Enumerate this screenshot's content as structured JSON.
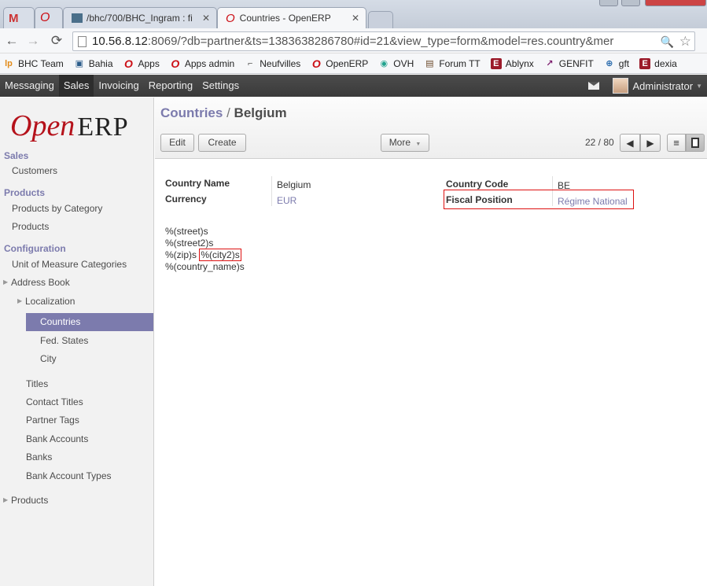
{
  "browser": {
    "tabs": [
      {
        "title": ""
      },
      {
        "title": ""
      },
      {
        "title": "/bhc/700/BHC_Ingram : fi"
      },
      {
        "title": "Countries - OpenERP"
      }
    ],
    "url_host": "10.56.8.12",
    "url_rest": ":8069/?db=partner&ts=1383638286780#id=21&view_type=form&model=res.country&mer",
    "bookmarks": [
      {
        "label": "BHC Team",
        "icon": "lp-icon",
        "color": "#e38c1a"
      },
      {
        "label": "Bahia",
        "icon": "bahia-icon",
        "color": "#2a5b8a"
      },
      {
        "label": "Apps",
        "icon": "opera-icon",
        "color": "#cc0f16"
      },
      {
        "label": "Apps admin",
        "icon": "opera-icon",
        "color": "#cc0f16"
      },
      {
        "label": "Neufvilles",
        "icon": "bookmark-icon",
        "color": "#555555"
      },
      {
        "label": "OpenERP",
        "icon": "opera-icon",
        "color": "#cc0f16"
      },
      {
        "label": "OVH",
        "icon": "ovh-icon",
        "color": "#22a38e"
      },
      {
        "label": "Forum TT",
        "icon": "forum-icon",
        "color": "#6b4a2b"
      },
      {
        "label": "Ablynx",
        "icon": "e-icon",
        "color": "#9b1a2a"
      },
      {
        "label": "GENFIT",
        "icon": "genfit-icon",
        "color": "#7a1a6b"
      },
      {
        "label": "gft",
        "icon": "globe-icon",
        "color": "#2266aa"
      },
      {
        "label": "dexia",
        "icon": "e-icon",
        "color": "#9b1a2a"
      }
    ]
  },
  "topmenu": {
    "items": [
      "Messaging",
      "Sales",
      "Invoicing",
      "Reporting",
      "Settings"
    ],
    "active": "Sales",
    "user": "Administrator"
  },
  "sidebar": {
    "logo_open": "Open",
    "logo_erp": "ERP",
    "sales": "Sales",
    "customers": "Customers",
    "products_section": "Products",
    "products_by_category": "Products by Category",
    "products": "Products",
    "configuration": "Configuration",
    "uom_categories": "Unit of Measure Categories",
    "address_book": "Address Book",
    "localization": "Localization",
    "countries": "Countries",
    "fed_states": "Fed. States",
    "city": "City",
    "titles": "Titles",
    "contact_titles": "Contact Titles",
    "partner_tags": "Partner Tags",
    "bank_accounts": "Bank Accounts",
    "banks": "Banks",
    "bank_account_types": "Bank Account Types",
    "products_bottom": "Products"
  },
  "header": {
    "breadcrumb_parent": "Countries",
    "breadcrumb_sep": "/",
    "breadcrumb_current": "Belgium",
    "edit": "Edit",
    "create": "Create",
    "more": "More",
    "pager": "22 / 80"
  },
  "form": {
    "country_name_label": "Country Name",
    "country_name": "Belgium",
    "currency_label": "Currency",
    "currency": "EUR",
    "country_code_label": "Country Code",
    "country_code": "BE",
    "fiscal_position_label": "Fiscal Position",
    "fiscal_position": "Régime National",
    "address_format": {
      "line1": "%(street)s",
      "line2": "%(street2)s",
      "line3_zip": "%(zip)s",
      "line3_city": "%(city2)s",
      "line4": "%(country_name)s"
    }
  },
  "colors": {
    "accent": "#7c7bad",
    "highlight_border": "#dd1111",
    "topbar": "#3f3f3f"
  }
}
